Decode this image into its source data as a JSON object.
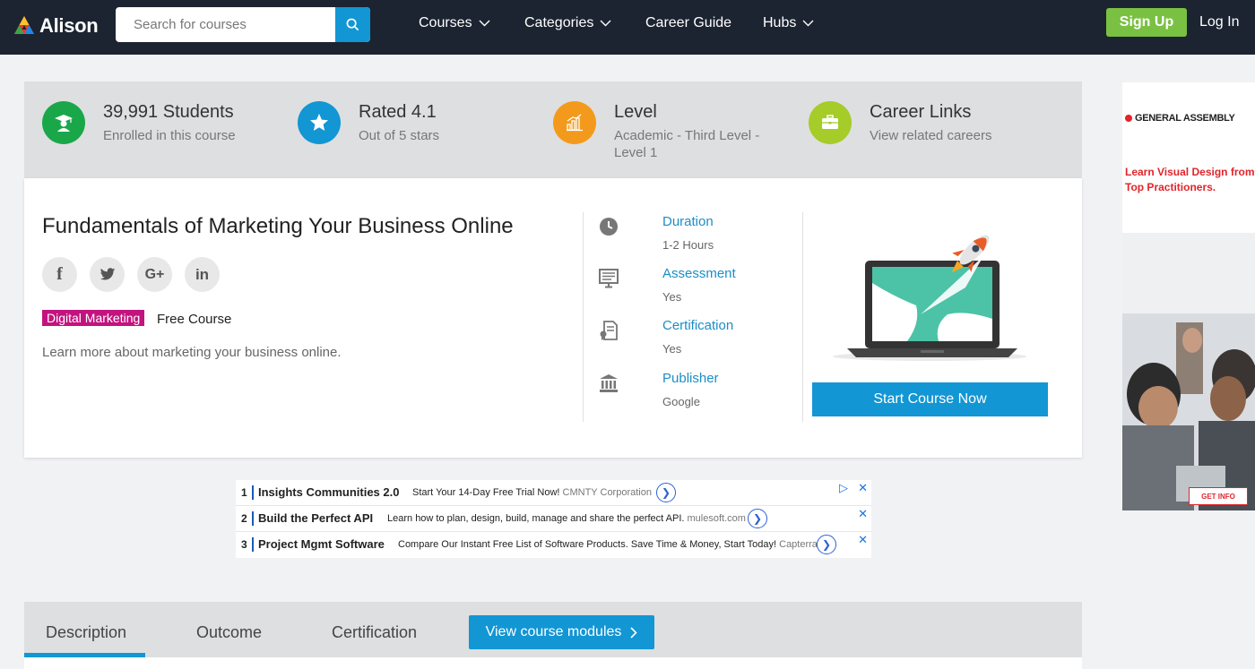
{
  "nav": {
    "logo_text": "Alison",
    "search_placeholder": "Search for courses",
    "items": [
      {
        "label": "Courses",
        "dropdown": true
      },
      {
        "label": "Categories",
        "dropdown": true
      },
      {
        "label": "Career Guide",
        "dropdown": false
      },
      {
        "label": "Hubs",
        "dropdown": true
      }
    ],
    "signup": "Sign Up",
    "login": "Log In"
  },
  "stats": [
    {
      "title": "39,991 Students",
      "sub": "Enrolled in this course",
      "icon": "graduate-icon",
      "color": "#1aa74a"
    },
    {
      "title": "Rated 4.1",
      "sub": "Out of 5 stars",
      "icon": "star-icon",
      "color": "#1296d4"
    },
    {
      "title": "Level",
      "sub": "Academic - Third Level - Level 1",
      "icon": "chart-icon",
      "color": "#f39a1d"
    },
    {
      "title": "Career Links",
      "sub": "View related careers",
      "icon": "briefcase-icon",
      "color": "#a5cc28"
    }
  ],
  "course": {
    "title": "Fundamentals of Marketing Your Business Online",
    "tag": "Digital Marketing",
    "price": "Free Course",
    "description": "Learn more about marketing your business online.",
    "start_button": "Start Course Now"
  },
  "details": [
    {
      "label": "Duration",
      "value": "1-2 Hours",
      "icon": "clock-icon"
    },
    {
      "label": "Assessment",
      "value": "Yes",
      "icon": "assessment-icon"
    },
    {
      "label": "Certification",
      "value": "Yes",
      "icon": "certificate-icon"
    },
    {
      "label": "Publisher",
      "value": "Google",
      "icon": "bank-icon"
    }
  ],
  "ads": [
    {
      "num": "1",
      "title": "Insights Communities 2.0",
      "text": "Start Your 14-Day Free Trial Now!",
      "source": "CMNTY Corporation"
    },
    {
      "num": "2",
      "title": "Build the Perfect API",
      "text": "Learn how to plan, design, build, manage and share the perfect API.",
      "source": "mulesoft.com"
    },
    {
      "num": "3",
      "title": "Project Mgmt Software",
      "text": "Compare Our Instant Free List of Software Products. Save Time & Money, Start Today!",
      "source": "Capterra"
    }
  ],
  "side_ad": {
    "brand": "GENERAL ASSEMBLY",
    "text": "Learn Visual Design from Top Practitioners.",
    "cta": "GET INFO"
  },
  "tabs": {
    "items": [
      "Description",
      "Outcome",
      "Certification"
    ],
    "modules_button": "View course modules"
  }
}
